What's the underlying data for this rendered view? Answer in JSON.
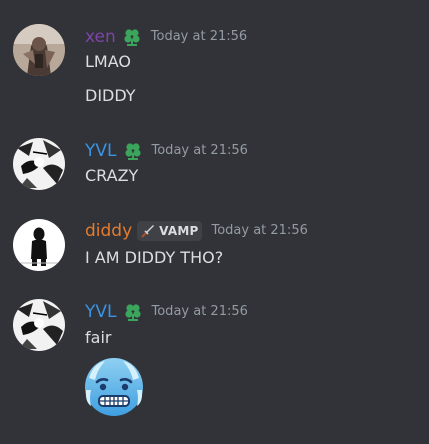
{
  "colors": {
    "background": "#313338",
    "username_xen": "#7e44a8",
    "username_yvl": "#3a94e3",
    "username_diddy": "#e57b2c",
    "badge_green": "#3ba55c",
    "timestamp": "#949ba4",
    "message_text": "#dbdee1",
    "role_tag_bg": "#3f4147"
  },
  "messages": [
    {
      "author": "xen",
      "badge_icon": "green-clover-icon",
      "timestamp": "Today at 21:56",
      "lines": [
        "LMAO",
        "DIDDY"
      ]
    },
    {
      "author": "YVL",
      "badge_icon": "green-clover-icon",
      "timestamp": "Today at 21:56",
      "lines": [
        "CRAZY"
      ]
    },
    {
      "author": "diddy",
      "role_tag": {
        "icon": "dagger-icon",
        "label": "VAMP"
      },
      "timestamp": "Today at 21:56",
      "lines": [
        "I AM DIDDY THO?"
      ]
    },
    {
      "author": "YVL",
      "badge_icon": "green-clover-icon",
      "timestamp": "Today at 21:56",
      "lines": [
        "fair"
      ],
      "emoji": "cold-face-emoji"
    }
  ]
}
